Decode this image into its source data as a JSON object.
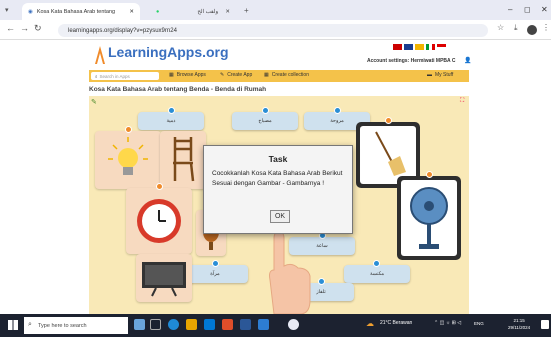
{
  "browser": {
    "tabs": [
      {
        "label": "Kosa Kata Bahasa Arab tentang"
      },
      {
        "label": "ولقب الح"
      }
    ],
    "new_tab": "+",
    "url": "learningapps.org/display?v=pzysux9rn24",
    "window_controls": {
      "minimize": "–",
      "maximize": "◻",
      "close": "✕"
    }
  },
  "site": {
    "logo": "LearningApps.org",
    "account_settings": "Account settings: Hermiwati MPBA C",
    "search_placeholder": "Search in Apps",
    "menu": {
      "browse": "Browse Apps",
      "create": "Create App",
      "collection": "Create collection",
      "my_stuff": "My Stuff"
    }
  },
  "app": {
    "title": "Kosa Kata Bahasa Arab tentang Benda - Benda di Rumah",
    "labels": [
      {
        "text": "دمية"
      },
      {
        "text": "مصباح"
      },
      {
        "text": "مروحة"
      },
      {
        "text": "ساعة"
      },
      {
        "text": "مرآة"
      },
      {
        "text": "مكنسة"
      },
      {
        "text": "تلفاز"
      }
    ]
  },
  "dialog": {
    "title": "Task",
    "message": "Cocokkanlah Kosa Kata Bahasa Arab Berikut Sesuai dengan Gambar - Gambarnya !",
    "ok": "OK"
  },
  "taskbar": {
    "search_placeholder": "Type here to search",
    "weather": "21°C  Berawan",
    "lang": "ENG",
    "time": "21:15",
    "date": "29/11/2024"
  },
  "colors": {
    "menubar": "#f4c24a",
    "app_bg": "#f9e9b7",
    "label_bg": "#cfe1ee",
    "pin_blue": "#2a8ed6",
    "pin_orange": "#f08b2b",
    "taskbar": "#1c2230"
  }
}
